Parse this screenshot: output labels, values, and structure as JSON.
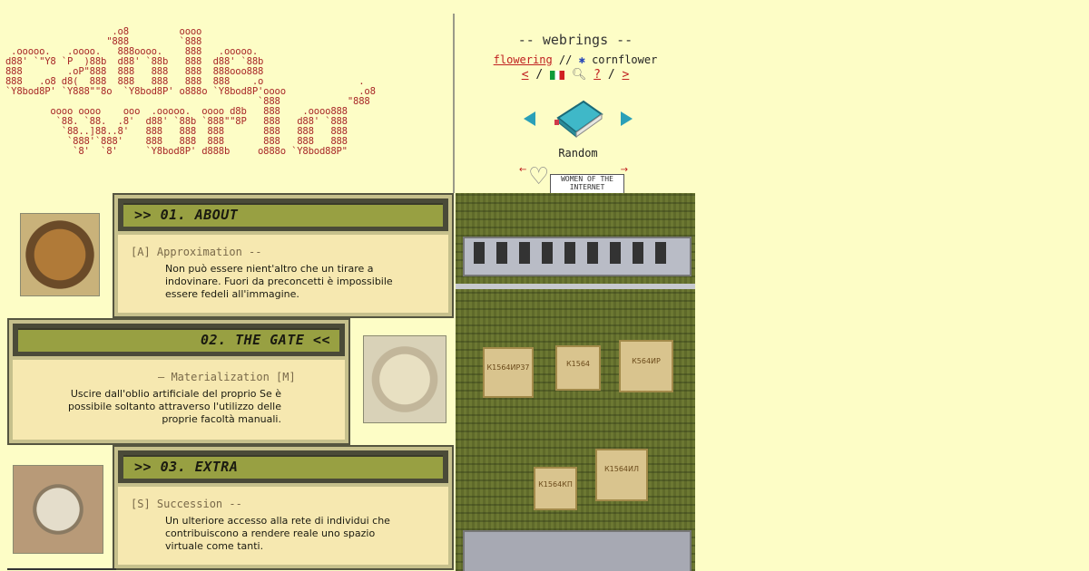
{
  "ascii_logo": "                   .o8         oooo\n                  \"888         `888\n .ooooo.   .oooo.   888oooo.    888   .ooooo.\nd88' `\"Y8 `P  )88b  d88' `88b   888  d88' `88b\n888        .oP\"888  888   888   888  888ooo888\n888   .o8 d8(  888  888   888   888  888    .o                 .\n`Y8bod8P' `Y888\"\"8o  `Y8bod8P' o888o `Y8bod8P'oooo             .o8\n                                             `888            \"888\n        oooo oooo    ooo  .ooooo.  oooo d8b   888    .oooo888\n         `88. `88.  .8'  d88' `88b `888\"\"8P   888   d88' `888\n          `88..]88..8'   888   888  888       888   888   888\n           `888'`888'    888   888  888       888   888   888\n            `8'  `8'     `Y8bod8P' d888b     o888o `Y8bod88P\"",
  "sidebar": {
    "title": "-- webrings --",
    "link_flowering": "flowering",
    "sep": "//",
    "link_cornflower": "cornflower",
    "nav_prev": "<",
    "nav_slash1": "/",
    "nav_q": "?",
    "nav_slash2": "/",
    "nav_slash3": "/",
    "nav_next": ">",
    "random_label": "Random",
    "woi_badge": "WOMEN OF THE INTERNET",
    "woi_prev": "←",
    "woi_next": "→"
  },
  "sections": {
    "about": {
      "heading": ">> 01. ABOUT",
      "subheading": "[A] Approximation --",
      "text": "Non può essere nient'altro che un tirare a indovinare. Fuori da preconcetti è impossibile essere fedeli all'immagine."
    },
    "gate": {
      "heading": "02. THE GATE <<",
      "subheading": "— Materialization [M]",
      "text": "Uscire dall'oblio artificiale del proprio Se è possibile soltanto attraverso l'utilizzo delle proprie facoltà manuali."
    },
    "extra": {
      "heading": ">> 03. EXTRA",
      "subheading": "[S] Succession --",
      "text": "Un ulteriore accesso alla rete di individui che contribuiscono a rendere reale uno spazio virtuale come tanti."
    }
  },
  "board": {
    "chips": [
      "К1564ИР37",
      "К1564",
      "К564ИР",
      "К1564КП",
      "К1564ИЛ"
    ]
  },
  "colors": {
    "background": "#fdfdc6",
    "ascii": "#a82828",
    "header_bar": "#98a042",
    "panel_body": "#f6e8b0",
    "accent_link": "#c02020"
  }
}
